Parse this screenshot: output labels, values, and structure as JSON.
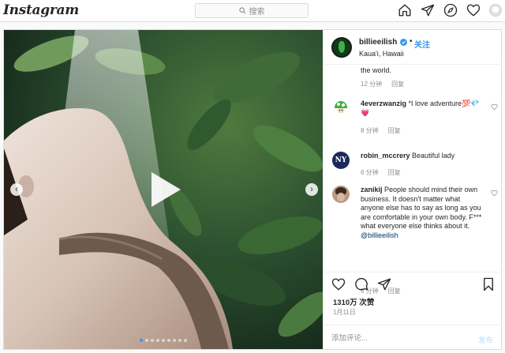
{
  "nav": {
    "logo": "Instagram",
    "search_placeholder": "搜索"
  },
  "post": {
    "username": "billieeilish",
    "separator": "•",
    "follow_label": "关注",
    "location": "Kaua'i, Hawaii",
    "media": {
      "type": "video",
      "carousel_dots": 9,
      "active_dot": 0
    },
    "caption_tail": "the world.",
    "caption_meta": {
      "time": "12 分钟",
      "reply": "回复"
    },
    "comments": [
      {
        "avatar": "mushroom",
        "username": "4everzwanzig",
        "text": "*I love adventure💯💎💗",
        "time": "8 分钟",
        "reply": "回复"
      },
      {
        "avatar": "ny-logo",
        "avatar_text": "NY",
        "username": "robin_mccrery",
        "text": "Beautiful lady",
        "time": "6 分钟",
        "reply": "回复"
      },
      {
        "avatar": "photo",
        "username": "zanikij",
        "text": "People should mind their own business. It doesn't matter what anyone else has to say as long as you are comfortable in your own body. F*** what everyone else thinks about it.",
        "mention": "@billieeilish",
        "time": "5 分钟",
        "reply": "回复"
      }
    ],
    "likes": "1310万 次赞",
    "date": "1月11日",
    "comment_placeholder": "添加评论...",
    "post_button": "发布"
  },
  "colors": {
    "accent_blue": "#3897f0",
    "post_button_disabled": "#b2dffc",
    "heart_pink": "#ed4956"
  }
}
